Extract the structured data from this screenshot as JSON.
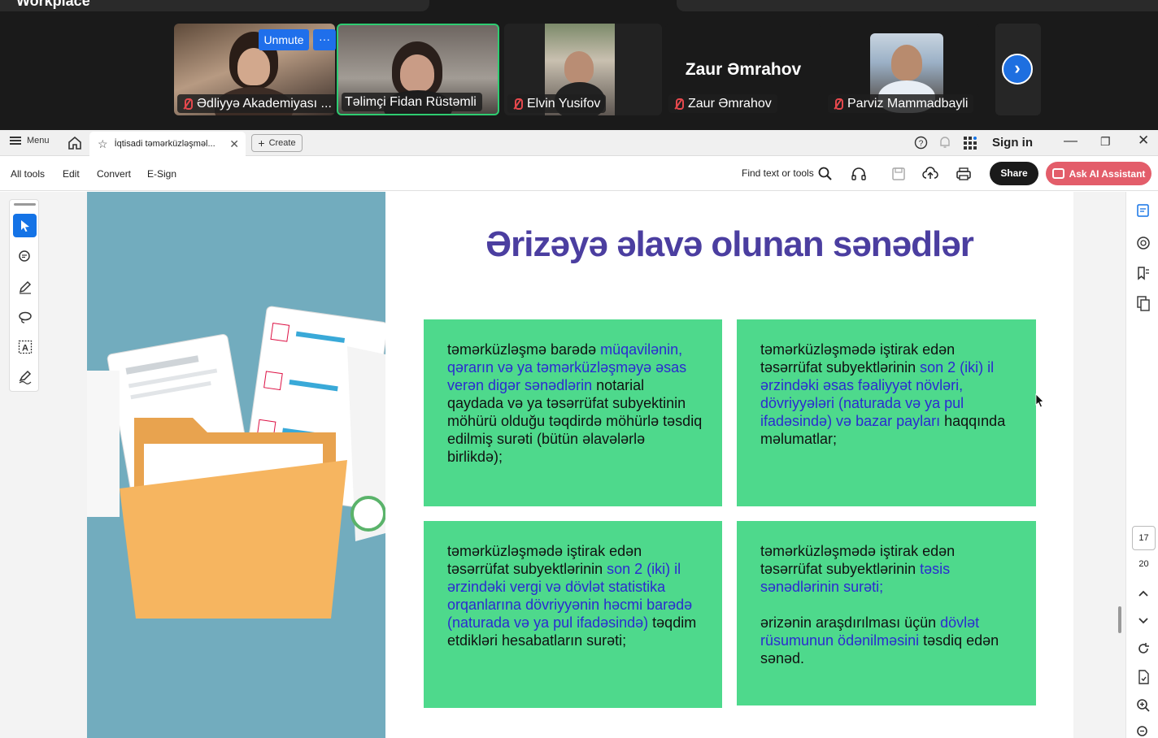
{
  "meeting": {
    "title": "Workplace",
    "unmute_label": "Unmute",
    "more_label": "···",
    "participants": [
      {
        "name": "Ədliyyə Akademiyası ..."
      },
      {
        "name": "Təlimçi Fidan Rüstəmli"
      },
      {
        "name": "Elvin Yusifov"
      },
      {
        "name": "Zaur Əmrahov",
        "display_name": "Zaur Əmrahov"
      },
      {
        "name": "Parviz Mammadbayli"
      }
    ],
    "next_label": "›"
  },
  "tabbar": {
    "menu_label": "Menu",
    "tab_title": "İqtisadi təmərküzləşməl...",
    "tab_close": "✕",
    "create_label": "Create",
    "signin_label": "Sign in",
    "minimize": "—",
    "restore": "❐",
    "close": "✕"
  },
  "toolbar": {
    "items": [
      "All tools",
      "Edit",
      "Convert",
      "E-Sign"
    ],
    "find_label": "Find text or tools",
    "share_label": "Share",
    "ai_label": "Ask AI Assistant"
  },
  "document": {
    "heading": "Ərizəyə əlavə olunan sənədlər",
    "cards": [
      {
        "parts": [
          {
            "t": "təmərküzləşmə barədə ",
            "h": false
          },
          {
            "t": "müqavilənin, qərarın və ya təmərküzləşməyə əsas verən digər sənədlərin",
            "h": true
          },
          {
            "t": " notarial qaydada və ya təsərrüfat subyektinin möhürü olduğu təqdirdə möhürlə təsdiq edilmiş surəti (bütün əlavələrlə birlikdə);",
            "h": false
          }
        ]
      },
      {
        "parts": [
          {
            "t": "təmərküzləşmədə iştirak edən təsərrüfat subyektlərinin ",
            "h": false
          },
          {
            "t": "son 2 (iki) il ərzindəki əsas fəaliyyət növləri, dövriyyələri (naturada və ya pul ifadəsində) və bazar payları",
            "h": true
          },
          {
            "t": " haqqında məlumatlar;",
            "h": false
          }
        ]
      },
      {
        "parts": [
          {
            "t": "təmərküzləşmədə iştirak edən təsərrüfat subyektlərinin ",
            "h": false
          },
          {
            "t": "son 2 (iki) il ərzindəki vergi və dövlət statistika orqanlarına dövriyyənin həcmi barədə (naturada və ya pul ifadəsində)",
            "h": true
          },
          {
            "t": " təqdim etdikləri hesabatların surəti;",
            "h": false
          }
        ]
      },
      {
        "parts": [
          {
            "t": "təmərküzləşmədə iştirak edən təsərrüfat subyektlərinin ",
            "h": false
          },
          {
            "t": "təsis sənədlərinin surəti;",
            "h": true
          },
          {
            "t": "\n\nərizənin araşdırılması üçün ",
            "h": false
          },
          {
            "t": "dövlət rüsumunun ödənilməsini",
            "h": true
          },
          {
            "t": " təsdiq edən sənəd.",
            "h": false
          }
        ]
      }
    ]
  },
  "pager": {
    "current": "17",
    "total": "20"
  },
  "colors": {
    "accent": "#1473e6",
    "card": "#4ed98c",
    "heading": "#4b3ea0",
    "highlight": "#2b2bd0",
    "panel": "#72acbe"
  }
}
